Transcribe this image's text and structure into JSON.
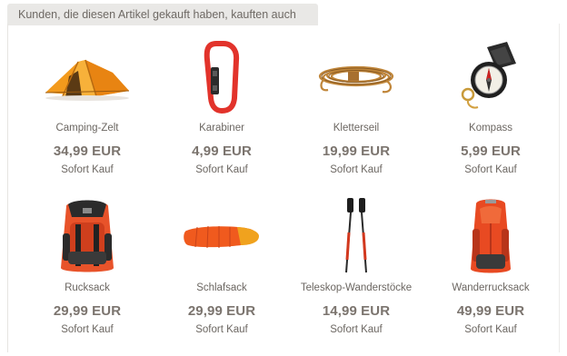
{
  "section": {
    "title": "Kunden, die diesen Artikel gekauft haben, kauften auch"
  },
  "products": [
    {
      "name": "Camping-Zelt",
      "price": "34,99 EUR",
      "action": "Sofort Kauf",
      "icon": "tent-icon"
    },
    {
      "name": "Karabiner",
      "price": "4,99 EUR",
      "action": "Sofort Kauf",
      "icon": "carabiner-icon"
    },
    {
      "name": "Kletterseil",
      "price": "19,99 EUR",
      "action": "Sofort Kauf",
      "icon": "rope-icon"
    },
    {
      "name": "Kompass",
      "price": "5,99 EUR",
      "action": "Sofort Kauf",
      "icon": "compass-icon"
    },
    {
      "name": "Rucksack",
      "price": "29,99 EUR",
      "action": "Sofort Kauf",
      "icon": "backpack-icon"
    },
    {
      "name": "Schlafsack",
      "price": "29,99 EUR",
      "action": "Sofort Kauf",
      "icon": "sleeping-bag-icon"
    },
    {
      "name": "Teleskop-Wanderstöcke",
      "price": "14,99 EUR",
      "action": "Sofort Kauf",
      "icon": "trekking-poles-icon"
    },
    {
      "name": "Wanderrucksack",
      "price": "49,99 EUR",
      "action": "Sofort Kauf",
      "icon": "hiking-backpack-icon"
    }
  ],
  "colors": {
    "accent_orange": "#f07a1e",
    "carabiner_red": "#e2332b",
    "text": "#6b6661"
  }
}
